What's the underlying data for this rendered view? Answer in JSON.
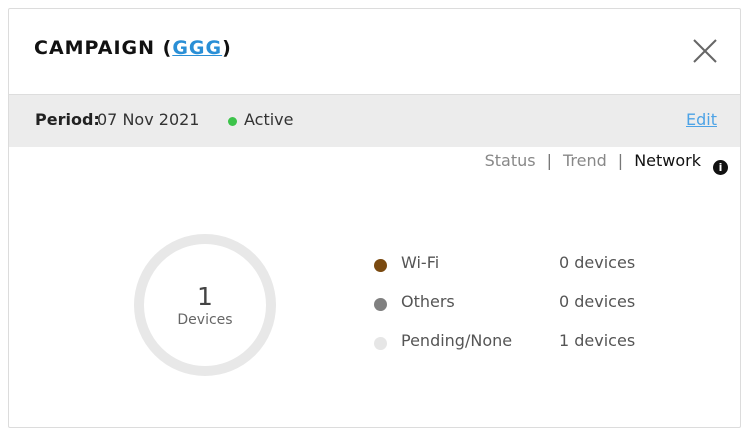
{
  "header": {
    "title_prefix": "CAMPAIGN (",
    "title_link": "GGG",
    "title_suffix": ")"
  },
  "period": {
    "label": "Period:",
    "value": "07 Nov 2021",
    "status": "Active",
    "status_color": "#3cc34a",
    "edit_label": "Edit"
  },
  "tabs": [
    {
      "label": "Status",
      "active": false
    },
    {
      "label": "Trend",
      "active": false
    },
    {
      "label": "Network",
      "active": true
    }
  ],
  "info_icon": "info-icon",
  "summary": {
    "total": "1",
    "label": "Devices"
  },
  "legend": [
    {
      "name": "Wi-Fi",
      "count": "0 devices",
      "color": "#7a4a10"
    },
    {
      "name": "Others",
      "count": "0 devices",
      "color": "#808080"
    },
    {
      "name": "Pending/None",
      "count": "1 devices",
      "color": "#e6e6e6"
    }
  ]
}
